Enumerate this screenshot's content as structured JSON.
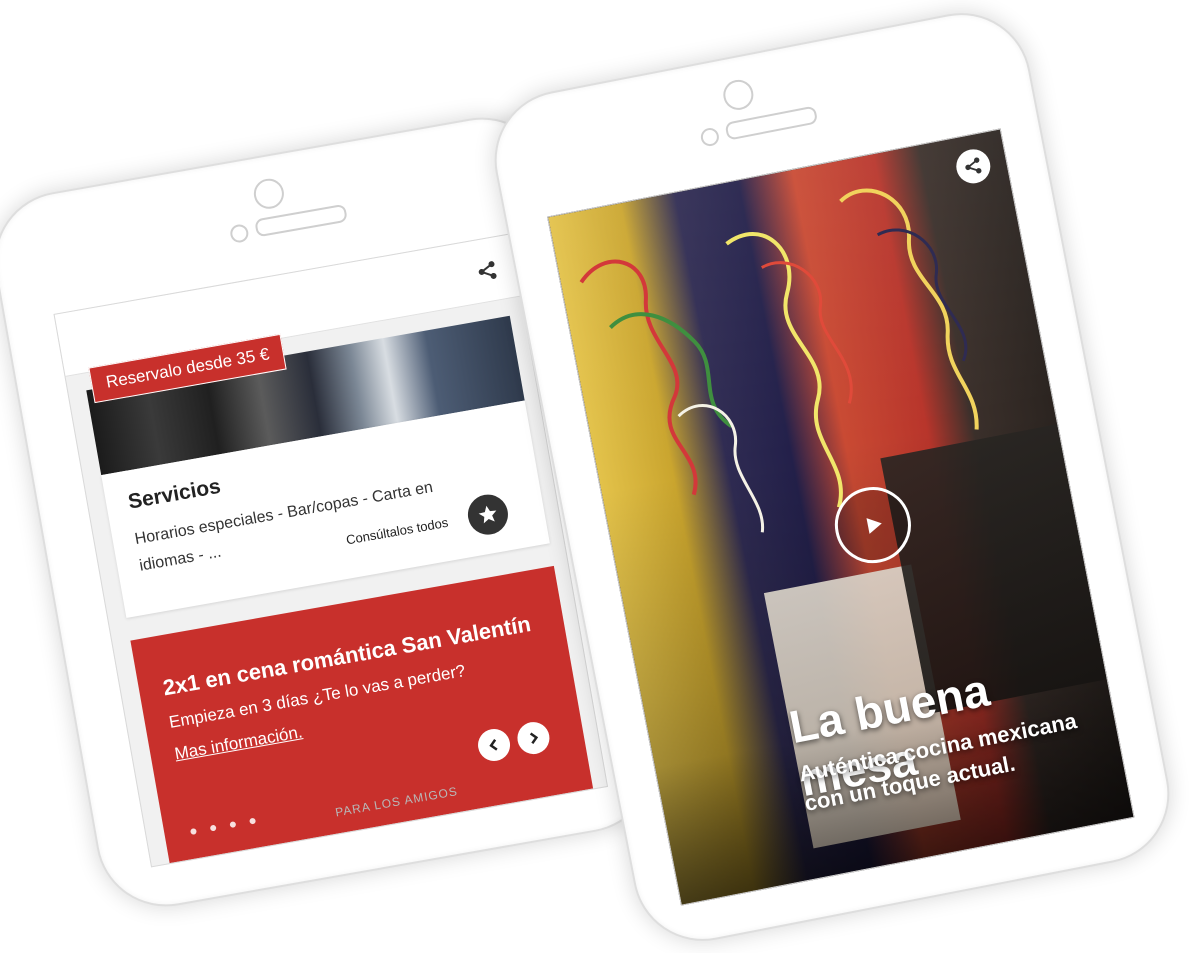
{
  "left_phone": {
    "tag": "Reservalo desde 35 €",
    "services": {
      "title": "Servicios",
      "description": "Horarios especiales - Bar/copas - Carta en idiomas - ...",
      "link": "Consúltalos todos"
    },
    "promo": {
      "title": "2x1 en cena romántica San Valentín",
      "subtitle": "Empieza en 3 días ¿Te lo vas a perder?",
      "link": "Mas información."
    },
    "footer_label": "PARA LOS AMIGOS",
    "icons": [
      "share-icon",
      "star-icon",
      "chevron-left-icon",
      "chevron-right-icon"
    ]
  },
  "right_phone": {
    "title": "La buena mesa",
    "subtitle": "Auténtica cocina mexicana con un toque actual.",
    "icons": [
      "share-icon",
      "play-icon"
    ]
  },
  "colors": {
    "accent": "#c8302c",
    "text_dark": "#222222",
    "screen_bg": "#f1f1f1"
  }
}
